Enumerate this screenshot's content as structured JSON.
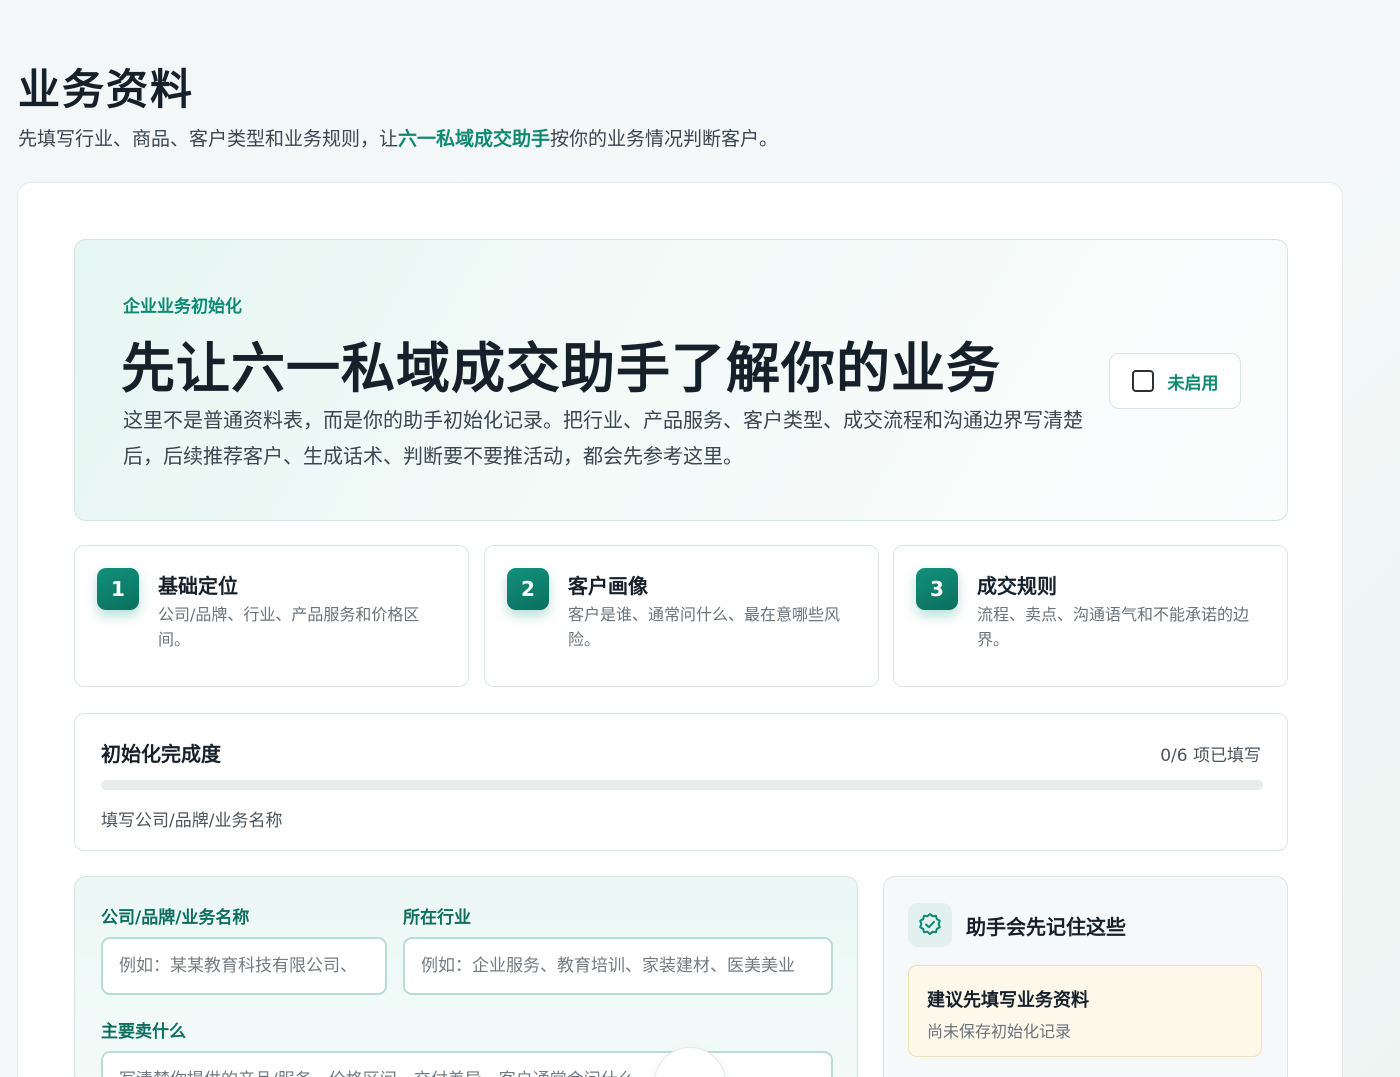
{
  "page": {
    "title": "业务资料",
    "subtitle_before": "先填写行业、商品、客户类型和业务规则，让",
    "subtitle_accent": "六一私域成交助手",
    "subtitle_after": "按你的业务情况判断客户。"
  },
  "hero": {
    "eyebrow": "企业业务初始化",
    "title": "先让六一私域成交助手了解你的业务",
    "description": "这里不是普通资料表，而是你的助手初始化记录。把行业、产品服务、客户类型、成交流程和沟通边界写清楚后，后续推荐客户、生成话术、判断要不要推活动，都会先参考这里。",
    "toggle_label": "未启用",
    "toggle_checked": false
  },
  "steps": [
    {
      "num": "1",
      "title": "基础定位",
      "desc": "公司/品牌、行业、产品服务和价格区间。"
    },
    {
      "num": "2",
      "title": "客户画像",
      "desc": "客户是谁、通常问什么、最在意哪些风险。"
    },
    {
      "num": "3",
      "title": "成交规则",
      "desc": "流程、卖点、沟通语气和不能承诺的边界。"
    }
  ],
  "progress": {
    "title": "初始化完成度",
    "count_text": "0/6 项已填写",
    "filled": 0,
    "total": 6,
    "hint": "填写公司/品牌/业务名称"
  },
  "form": {
    "company_label": "公司/品牌/业务名称",
    "company_placeholder": "例如：某某教育科技有限公司、",
    "industry_label": "所在行业",
    "industry_placeholder": "例如：企业服务、教育培训、家装建材、医美美业",
    "product_label": "主要卖什么",
    "product_placeholder": "写清楚你提供的产品/服务、价格区间、交付差异、客户通常会问什么"
  },
  "side": {
    "title": "助手会先记住这些",
    "notice_title": "建议先填写业务资料",
    "notice_desc": "尚未保存初始化记录"
  },
  "colors": {
    "accent": "#0e8a73",
    "notice_bg": "#fdf8ea"
  }
}
